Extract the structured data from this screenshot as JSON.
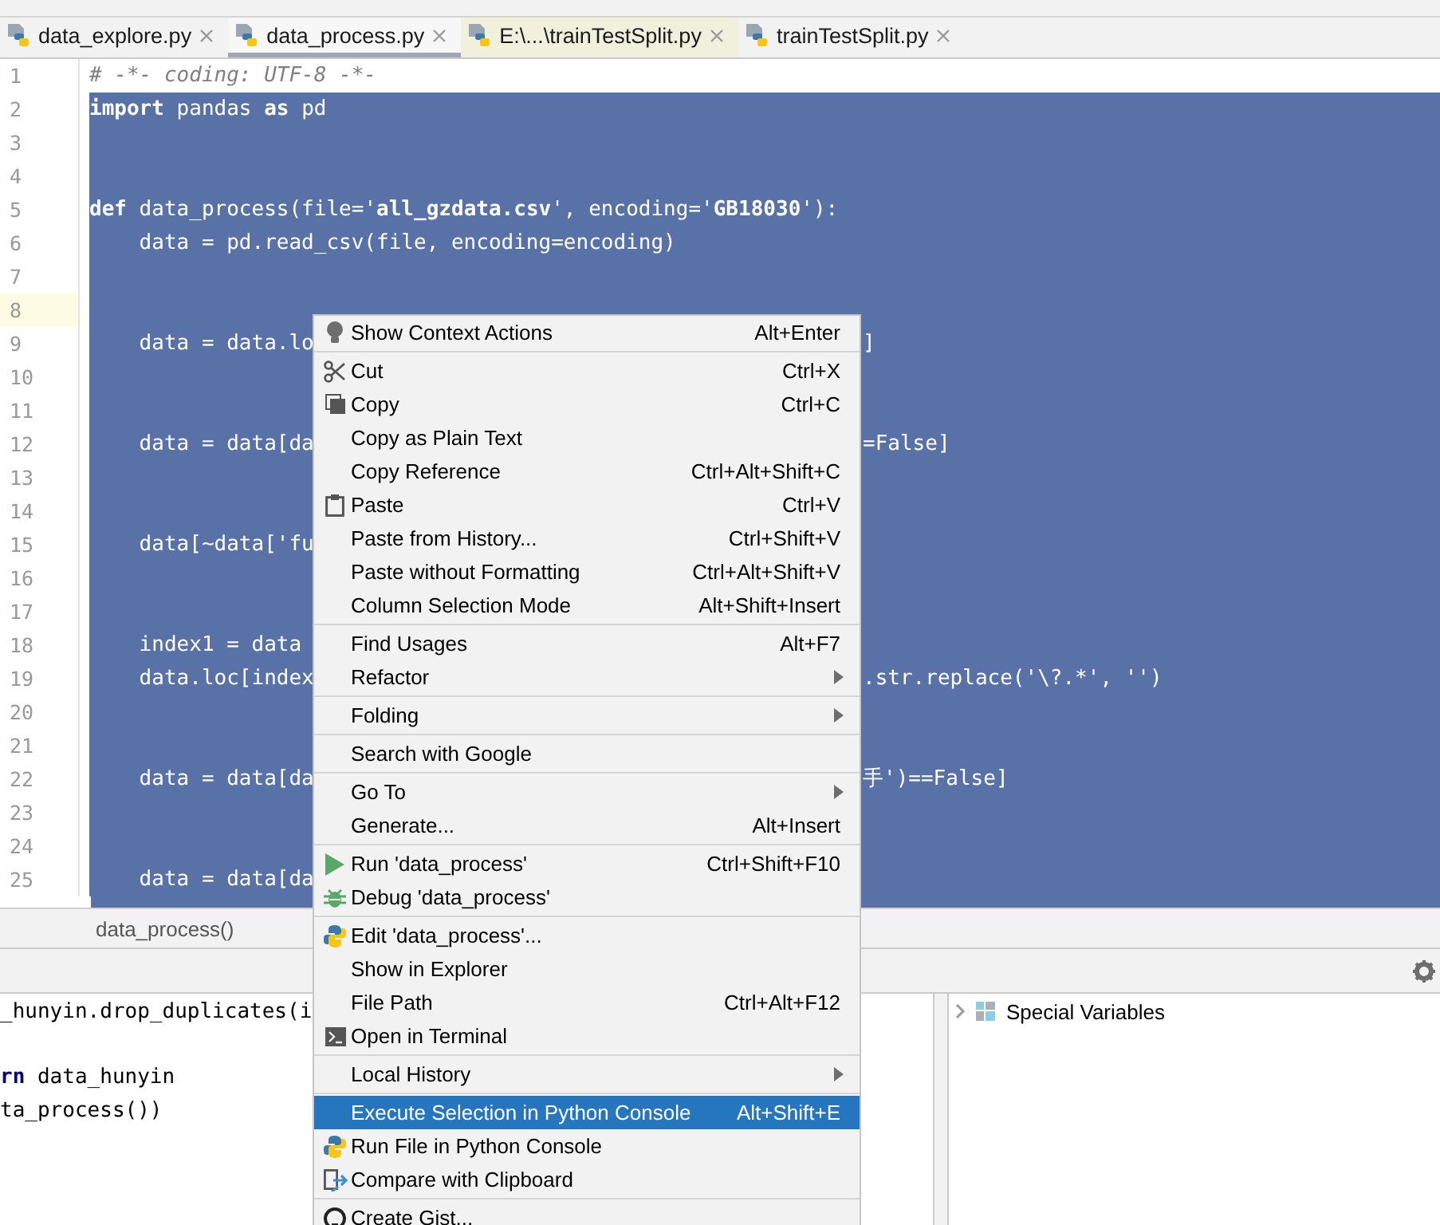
{
  "tabs": [
    {
      "label": "data_explore.py",
      "selected": false,
      "highlighted": false
    },
    {
      "label": "data_process.py",
      "selected": true,
      "highlighted": false
    },
    {
      "label": "E:\\...\\trainTestSplit.py",
      "selected": false,
      "highlighted": true
    },
    {
      "label": "trainTestSplit.py",
      "selected": false,
      "highlighted": false
    }
  ],
  "editor": {
    "lines": [
      {
        "number": "1",
        "kind": "comment",
        "left": "# -*- coding: UTF-8 -*-",
        "selected": false,
        "current": false
      },
      {
        "number": "2",
        "kind": "code",
        "left": "**import** pandas **as** pd",
        "selected": true,
        "current": false
      },
      {
        "number": "3",
        "kind": "code",
        "selected": true,
        "current": false
      },
      {
        "number": "4",
        "kind": "code",
        "selected": true,
        "current": false
      },
      {
        "number": "5",
        "kind": "code",
        "left": "**def** data_process(file='**all_gzdata.csv**', encoding='**GB18030**'):",
        "selected": true,
        "current": false
      },
      {
        "number": "6",
        "kind": "code",
        "left": "    data = pd.read_csv(file, encoding=encoding)",
        "selected": true,
        "current": false
      },
      {
        "number": "7",
        "kind": "code",
        "selected": true,
        "current": false
      },
      {
        "number": "8",
        "kind": "code",
        "selected": true,
        "current": true
      },
      {
        "number": "9",
        "kind": "code",
        "left": "    data = data.lo",
        "right": "]",
        "selected": true,
        "current": false
      },
      {
        "number": "10",
        "kind": "code",
        "selected": true,
        "current": false
      },
      {
        "number": "11",
        "kind": "code",
        "selected": true,
        "current": false
      },
      {
        "number": "12",
        "kind": "code",
        "left": "    data = data[da",
        "right": "=False]",
        "selected": true,
        "current": false
      },
      {
        "number": "13",
        "kind": "code",
        "selected": true,
        "current": false
      },
      {
        "number": "14",
        "kind": "code",
        "selected": true,
        "current": false
      },
      {
        "number": "15",
        "kind": "code",
        "left": "    data[~data['fu",
        "selected": true,
        "current": false
      },
      {
        "number": "16",
        "kind": "code",
        "selected": true,
        "current": false
      },
      {
        "number": "17",
        "kind": "code",
        "selected": true,
        "current": false
      },
      {
        "number": "18",
        "kind": "code",
        "left": "    index1 = data",
        "selected": true,
        "current": false
      },
      {
        "number": "19",
        "kind": "code",
        "left": "    data.loc[index",
        "right": ".str.replace('\\?.*', '')",
        "selected": true,
        "current": false
      },
      {
        "number": "20",
        "kind": "code",
        "selected": true,
        "current": false
      },
      {
        "number": "21",
        "kind": "code",
        "selected": true,
        "current": false
      },
      {
        "number": "22",
        "kind": "code",
        "left": "    data = data[da",
        "right": "手')==False]",
        "selected": true,
        "current": false
      },
      {
        "number": "23",
        "kind": "code",
        "selected": true,
        "current": false
      },
      {
        "number": "24",
        "kind": "code",
        "selected": true,
        "current": false
      },
      {
        "number": "25",
        "kind": "code",
        "left": "    data = data[da",
        "selected": true,
        "current": false
      }
    ]
  },
  "breadcrumb": "data_process()",
  "console": {
    "lines": [
      {
        "text": "_hunyin.drop_duplicates(i"
      },
      {
        "text": "**rn** data_hunyin"
      },
      {
        "text": "ta_process())"
      }
    ]
  },
  "variables": {
    "items": [
      {
        "label": "Special Variables",
        "expanded": false
      }
    ]
  },
  "context_menu": {
    "groups": [
      [
        {
          "label": "Show Context Actions",
          "shortcut": "Alt+Enter",
          "kind": "bulb",
          "submenu": false,
          "selected": false
        }
      ],
      [
        {
          "label": "Cut",
          "shortcut": "Ctrl+X",
          "kind": "scissors",
          "submenu": false,
          "selected": false
        },
        {
          "label": "Copy",
          "shortcut": "Ctrl+C",
          "kind": "copy",
          "submenu": false,
          "selected": false
        },
        {
          "label": "Copy as Plain Text",
          "kind": "plain",
          "submenu": false,
          "selected": false
        },
        {
          "label": "Copy Reference",
          "shortcut": "Ctrl+Alt+Shift+C",
          "kind": "plain",
          "submenu": false,
          "selected": false
        },
        {
          "label": "Paste",
          "shortcut": "Ctrl+V",
          "kind": "clipboard",
          "submenu": false,
          "selected": false
        },
        {
          "label": "Paste from History...",
          "shortcut": "Ctrl+Shift+V",
          "kind": "plain",
          "submenu": false,
          "selected": false
        },
        {
          "label": "Paste without Formatting",
          "shortcut": "Ctrl+Alt+Shift+V",
          "kind": "plain",
          "submenu": false,
          "selected": false
        },
        {
          "label": "Column Selection Mode",
          "shortcut": "Alt+Shift+Insert",
          "kind": "plain",
          "submenu": false,
          "selected": false
        }
      ],
      [
        {
          "label": "Find Usages",
          "shortcut": "Alt+F7",
          "kind": "plain",
          "submenu": false,
          "selected": false
        },
        {
          "label": "Refactor",
          "kind": "plain",
          "submenu": true,
          "selected": false
        }
      ],
      [
        {
          "label": "Folding",
          "kind": "plain",
          "submenu": true,
          "selected": false
        }
      ],
      [
        {
          "label": "Search with Google",
          "kind": "plain",
          "submenu": false,
          "selected": false
        }
      ],
      [
        {
          "label": "Go To",
          "kind": "plain",
          "submenu": true,
          "selected": false
        },
        {
          "label": "Generate...",
          "shortcut": "Alt+Insert",
          "kind": "plain",
          "submenu": false,
          "selected": false
        }
      ],
      [
        {
          "label": "Run 'data_process'",
          "shortcut": "Ctrl+Shift+F10",
          "kind": "play",
          "submenu": false,
          "selected": false
        },
        {
          "label": "Debug 'data_process'",
          "kind": "bug",
          "submenu": false,
          "selected": false
        }
      ],
      [
        {
          "label": "Edit 'data_process'...",
          "kind": "python",
          "submenu": false,
          "selected": false
        },
        {
          "label": "Show in Explorer",
          "kind": "plain",
          "submenu": false,
          "selected": false
        },
        {
          "label": "File Path",
          "shortcut": "Ctrl+Alt+F12",
          "kind": "plain",
          "submenu": false,
          "selected": false
        },
        {
          "label": "Open in Terminal",
          "kind": "terminal",
          "submenu": false,
          "selected": false
        }
      ],
      [
        {
          "label": "Local History",
          "kind": "plain",
          "submenu": true,
          "selected": false
        }
      ],
      [
        {
          "label": "Execute Selection in Python Console",
          "shortcut": "Alt+Shift+E",
          "kind": "plain",
          "submenu": false,
          "selected": true
        },
        {
          "label": "Run File in Python Console",
          "kind": "python",
          "submenu": false,
          "selected": false
        },
        {
          "label": "Compare with Clipboard",
          "kind": "compare",
          "submenu": false,
          "selected": false
        }
      ],
      [
        {
          "label": "Create Gist...",
          "kind": "github",
          "submenu": false,
          "selected": false
        }
      ]
    ]
  }
}
